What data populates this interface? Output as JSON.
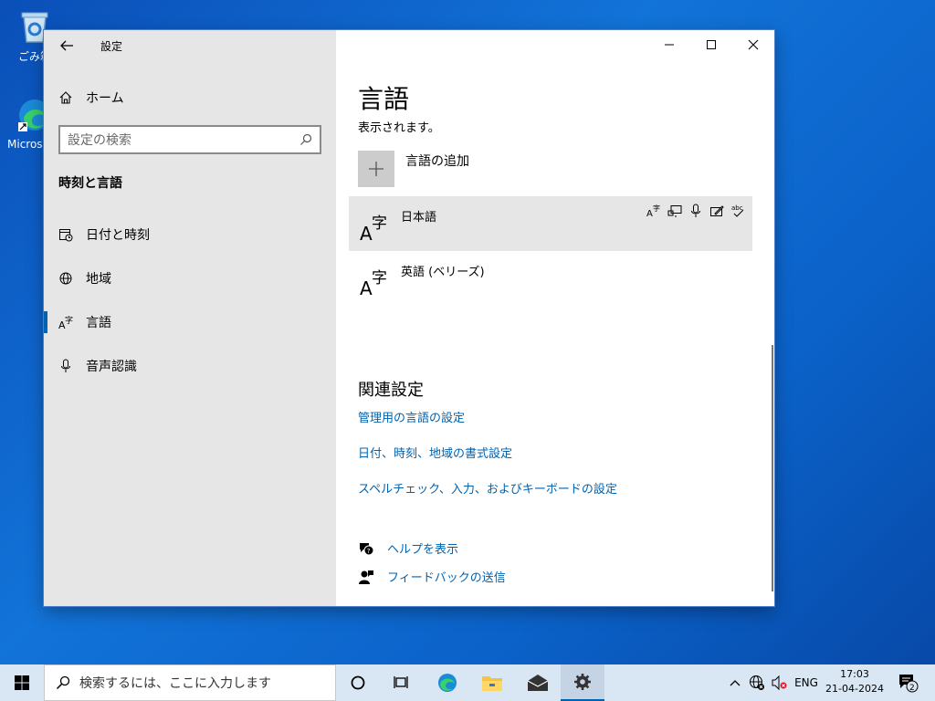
{
  "desktop": {
    "recycle_label": "ごみ箱",
    "edge_label": "Microsoft Edge"
  },
  "window": {
    "title": "設定",
    "sidebar": {
      "home_label": "ホーム",
      "search_placeholder": "設定の検索",
      "section_title": "時刻と言語",
      "items": [
        {
          "label": "日付と時刻",
          "icon": "calendar-clock-icon"
        },
        {
          "label": "地域",
          "icon": "globe-region-icon"
        },
        {
          "label": "言語",
          "icon": "language-icon",
          "active": true
        },
        {
          "label": "音声認識",
          "icon": "microphone-icon"
        }
      ]
    },
    "main": {
      "page_title": "言語",
      "subtext": "表示されます。",
      "add_language_label": "言語の追加",
      "languages": [
        {
          "name": "日本語",
          "selected": true,
          "features": [
            "display-language-icon",
            "text-to-speech-icon",
            "speech-recognition-icon",
            "handwriting-icon",
            "spellcheck-icon"
          ]
        },
        {
          "name": "英語 (ベリーズ)",
          "selected": false
        }
      ],
      "related_title": "関連設定",
      "links": [
        "管理用の言語の設定",
        "日付、時刻、地域の書式設定",
        "スペルチェック、入力、およびキーボードの設定"
      ],
      "help_label": "ヘルプを表示",
      "feedback_label": "フィードバックの送信"
    }
  },
  "taskbar": {
    "search_placeholder": "検索するには、ここに入力します",
    "lang_indicator": "ENG",
    "time": "17:03",
    "date": "21-04-2024",
    "notification_count": "2"
  },
  "colors": {
    "accent": "#0063b1",
    "sidebar_bg": "#e6e6e6",
    "taskbar_bg": "#d9e6f3"
  }
}
